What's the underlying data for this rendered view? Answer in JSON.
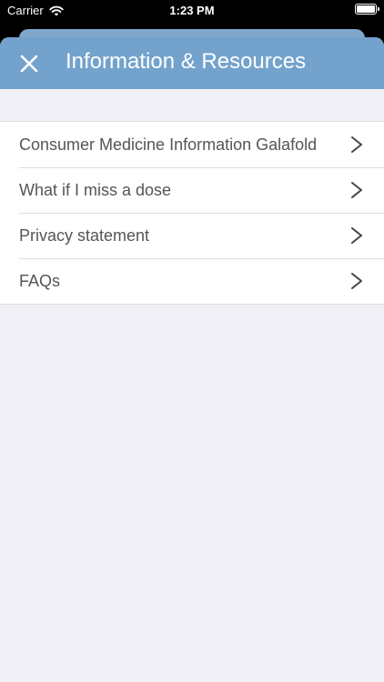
{
  "status": {
    "carrier": "Carrier",
    "time": "1:23 PM"
  },
  "nav": {
    "title": "Information & Resources",
    "close_icon": "close-icon"
  },
  "items": [
    {
      "label": "Consumer Medicine Information Galafold"
    },
    {
      "label": "What if I miss a dose"
    },
    {
      "label": "Privacy statement"
    },
    {
      "label": "FAQs"
    }
  ],
  "colors": {
    "nav_background": "#73a3cc",
    "page_background": "#f1f0f6",
    "row_text": "#555555"
  }
}
